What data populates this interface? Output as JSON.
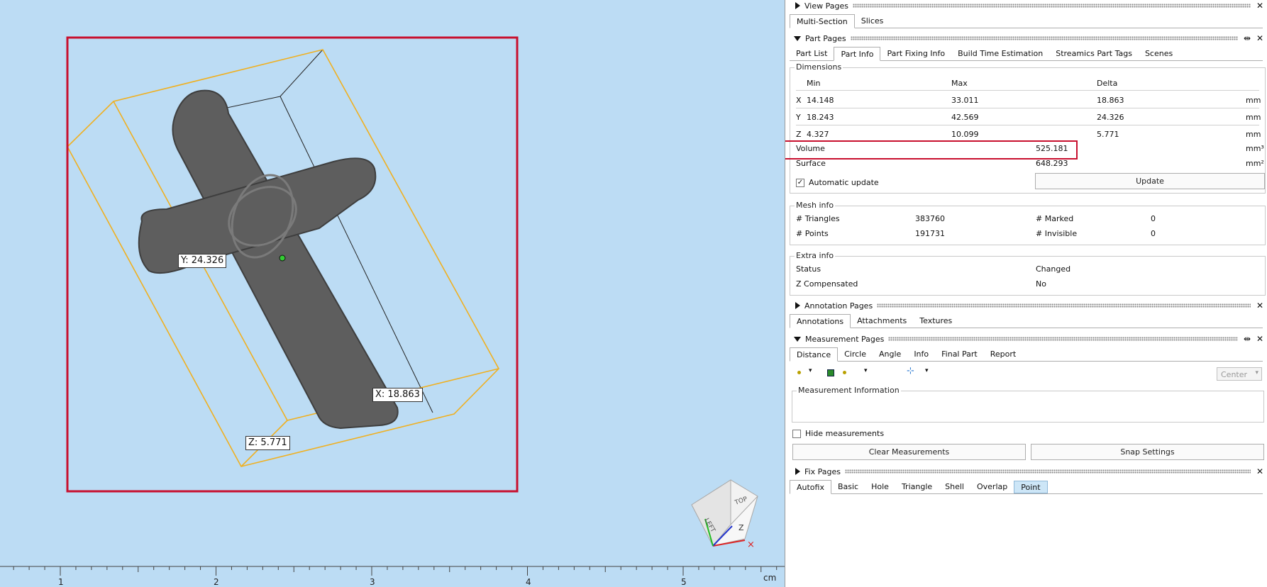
{
  "viewport": {
    "dim_labels": {
      "y": "Y: 24.326",
      "x": "X: 18.863",
      "z": "Z: 5.771"
    },
    "ruler": {
      "ticks": [
        "1",
        "2",
        "3",
        "4",
        "5"
      ],
      "unit": "cm"
    },
    "navcube": {
      "top": "TOP",
      "left": "LEFT",
      "z": "Z"
    },
    "colors": {
      "background": "#bcdcf4",
      "highlight": "#c8102e",
      "bbox": "#f0b020",
      "model": "#5e5e5e"
    }
  },
  "view_pages": {
    "title": "View Pages",
    "tabs": [
      "Multi-Section",
      "Slices"
    ],
    "active_tab": "Multi-Section"
  },
  "part_pages": {
    "title": "Part Pages",
    "tabs": [
      "Part List",
      "Part Info",
      "Part Fixing Info",
      "Build Time Estimation",
      "Streamics Part Tags",
      "Scenes"
    ],
    "active_tab": "Part Info",
    "dimensions": {
      "title": "Dimensions",
      "headers": {
        "min": "Min",
        "max": "Max",
        "delta": "Delta"
      },
      "rows": [
        {
          "axis": "X",
          "min": "14.148",
          "max": "33.011",
          "delta": "18.863",
          "unit": "mm"
        },
        {
          "axis": "Y",
          "min": "18.243",
          "max": "42.569",
          "delta": "24.326",
          "unit": "mm"
        },
        {
          "axis": "Z",
          "min": "4.327",
          "max": "10.099",
          "delta": "5.771",
          "unit": "mm"
        }
      ],
      "volume": {
        "label": "Volume",
        "value": "525.181",
        "unit": "mm³"
      },
      "surface": {
        "label": "Surface",
        "value": "648.293",
        "unit": "mm²"
      },
      "auto_update": {
        "label": "Automatic update",
        "checked": true
      },
      "update_button": "Update"
    },
    "mesh_info": {
      "title": "Mesh info",
      "triangles_label": "# Triangles",
      "triangles": "383760",
      "marked_label": "# Marked",
      "marked": "0",
      "points_label": "# Points",
      "points": "191731",
      "invisible_label": "# Invisible",
      "invisible": "0"
    },
    "extra_info": {
      "title": "Extra info",
      "status_label": "Status",
      "status": "Changed",
      "zcomp_label": "Z Compensated",
      "zcomp": "No"
    }
  },
  "annotation_pages": {
    "title": "Annotation Pages",
    "tabs": [
      "Annotations",
      "Attachments",
      "Textures"
    ],
    "active_tab": "Annotations"
  },
  "measurement_pages": {
    "title": "Measurement Pages",
    "tabs": [
      "Distance",
      "Circle",
      "Angle",
      "Info",
      "Final Part",
      "Report"
    ],
    "active_tab": "Distance",
    "snap_select": "Center",
    "info_title": "Measurement Information",
    "hide_label": "Hide measurements",
    "clear_button": "Clear Measurements",
    "snap_button": "Snap Settings"
  },
  "fix_pages": {
    "title": "Fix Pages",
    "tabs": [
      "Autofix",
      "Basic",
      "Hole",
      "Triangle",
      "Shell",
      "Overlap",
      "Point"
    ],
    "active_tab": "Autofix",
    "highlighted_tab": "Point"
  }
}
